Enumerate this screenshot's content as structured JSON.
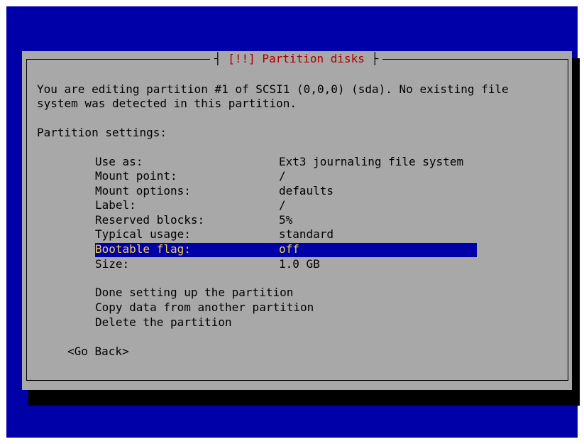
{
  "dialog": {
    "title": "[!!] Partition disks",
    "intro_line1": "You are editing partition #1 of SCSI1 (0,0,0) (sda). No existing file",
    "intro_line2": "system was detected in this partition.",
    "section_heading": "Partition settings:"
  },
  "settings": [
    {
      "label": "Use as:",
      "value": "Ext3 journaling file system"
    },
    {
      "label": "Mount point:",
      "value": "/"
    },
    {
      "label": "Mount options:",
      "value": "defaults"
    },
    {
      "label": "Label:",
      "value": "/"
    },
    {
      "label": "Reserved blocks:",
      "value": "5%"
    },
    {
      "label": "Typical usage:",
      "value": "standard"
    },
    {
      "label": "Bootable flag:",
      "value": "off"
    },
    {
      "label": "Size:",
      "value": "1.0 GB"
    }
  ],
  "actions": [
    "Done setting up the partition",
    "Copy data from another partition",
    "Delete the partition"
  ],
  "go_back_label": "<Go Back>",
  "colors": {
    "background": "#0000a8",
    "dialog": "#a8a8a8",
    "title_text": "#a80000",
    "selection_bg": "#0000a8",
    "selection_text": "#f5d442"
  }
}
